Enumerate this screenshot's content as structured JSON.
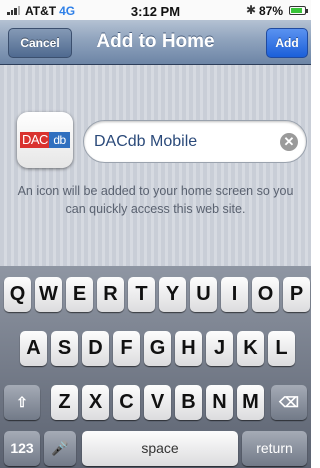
{
  "status_bar": {
    "carrier": "AT&T",
    "network": "4G",
    "time": "3:12 PM",
    "battery_text": "87%",
    "battery_level": 0.87,
    "icons": [
      "signal-icon",
      "bluetooth-icon",
      "battery-icon"
    ]
  },
  "nav": {
    "title": "Add to Home",
    "cancel_label": "Cancel",
    "add_label": "Add"
  },
  "bookmark": {
    "icon_text_dac": "DAC",
    "icon_text_db": "db",
    "name_value": "DACdb Mobile",
    "hint": "An icon will be added to your home screen so you can quickly access this web site."
  },
  "keyboard": {
    "row1": [
      "Q",
      "W",
      "E",
      "R",
      "T",
      "Y",
      "U",
      "I",
      "O",
      "P"
    ],
    "row2": [
      "A",
      "S",
      "D",
      "F",
      "G",
      "H",
      "J",
      "K",
      "L"
    ],
    "row3": [
      "Z",
      "X",
      "C",
      "V",
      "B",
      "N",
      "M"
    ],
    "numbers_label": "123",
    "space_label": "space",
    "return_label": "return"
  },
  "colors": {
    "nav_accent": "#6d85a6",
    "add_button": "#1b5fd9",
    "icon_red": "#d9322f",
    "icon_blue": "#2f6fbf"
  }
}
